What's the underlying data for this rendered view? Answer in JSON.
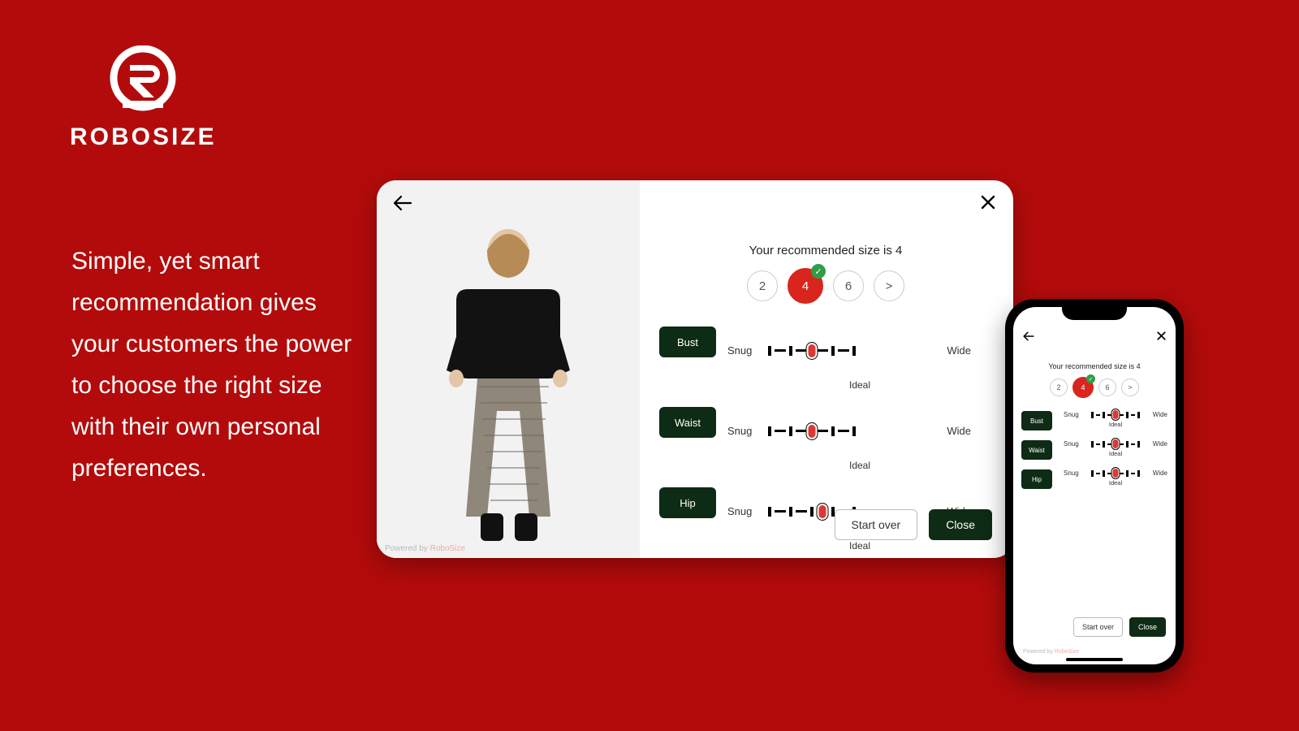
{
  "brand": {
    "name": "ROBOSIZE"
  },
  "copy": "Simple, yet smart recommendation gives your customers the power to choose the right size with their own personal preferences.",
  "widget": {
    "recommend_text": "Your recommended size is 4",
    "sizes": [
      {
        "label": "2",
        "selected": false
      },
      {
        "label": "4",
        "selected": true
      },
      {
        "label": "6",
        "selected": false
      },
      {
        "label": ">",
        "selected": false
      }
    ],
    "slider_common": {
      "snug": "Snug",
      "wide": "Wide",
      "ideal": "Ideal"
    },
    "sliders": [
      {
        "name": "Bust",
        "pos_pct": 50
      },
      {
        "name": "Waist",
        "pos_pct": 50
      },
      {
        "name": "Hip",
        "pos_pct": 62
      }
    ],
    "buttons": {
      "start_over": "Start over",
      "close": "Close"
    },
    "powered_prefix": "Powered by ",
    "powered_brand": "RoboSize"
  },
  "colors": {
    "accent": "#d8261f",
    "darkgreen": "#0e2b15"
  }
}
